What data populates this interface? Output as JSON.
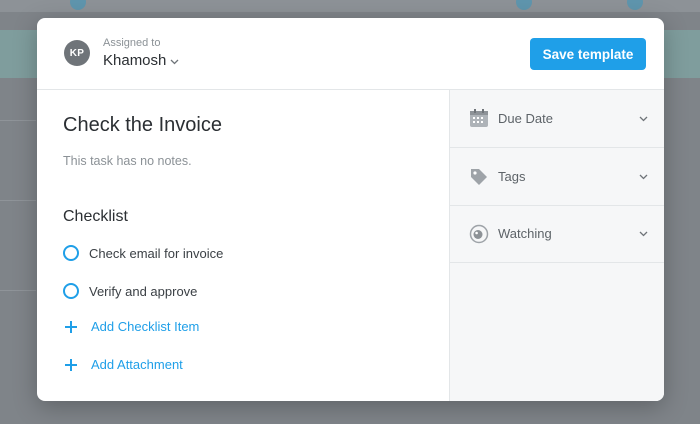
{
  "header": {
    "avatar_initials": "KP",
    "assigned_label": "Assigned to",
    "assignee": "Khamosh",
    "save_button": "Save template"
  },
  "task": {
    "title": "Check the Invoice",
    "notes": "This task has no notes."
  },
  "checklist": {
    "title": "Checklist",
    "items": [
      {
        "label": "Check email for invoice",
        "checked": false
      },
      {
        "label": "Verify and approve",
        "checked": false
      }
    ],
    "add_item": "Add Checklist Item"
  },
  "attachments": {
    "add": "Add Attachment"
  },
  "sidebar": {
    "items": [
      {
        "label": "Due Date",
        "icon": "calendar-icon"
      },
      {
        "label": "Tags",
        "icon": "tag-icon"
      },
      {
        "label": "Watching",
        "icon": "eye-icon"
      }
    ]
  },
  "colors": {
    "accent": "#1f9fe8",
    "overlay": "#7f8489"
  }
}
